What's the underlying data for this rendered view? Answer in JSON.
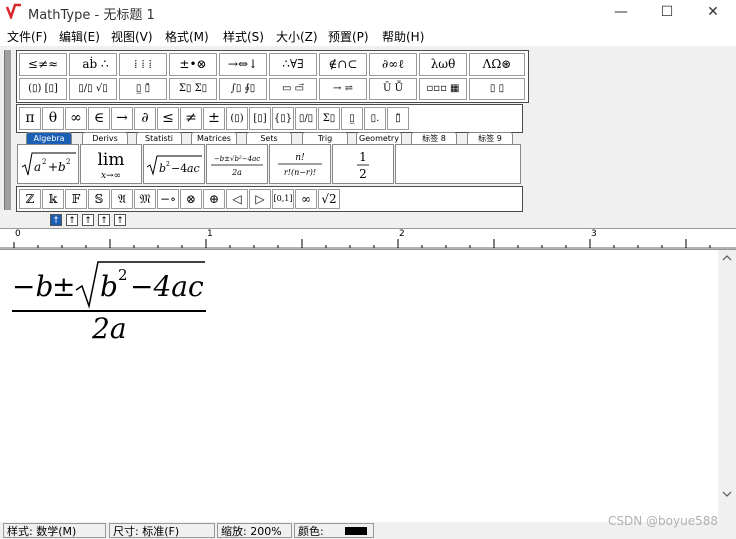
{
  "window": {
    "app_title": "MathType - 无标题 1",
    "minimize_glyph": "—",
    "maximize_glyph": "☐",
    "close_glyph": "✕"
  },
  "menu": [
    "文件(F)",
    "编辑(E)",
    "视图(V)",
    "格式(M)",
    "样式(S)",
    "大小(Z)",
    "预置(P)",
    "帮助(H)"
  ],
  "toolbar": {
    "row1": [
      "≤≠≈",
      "  aḃ ∴",
      "⁞ ⁞ ⁞",
      "±•⊗",
      "→⇔↓",
      "∴∀∃",
      "∉∩⊂",
      "∂∞ℓ",
      "λωθ",
      "ΛΩ⊛"
    ],
    "row2": [
      "(▯) [▯]",
      "▯/▯ √▯",
      "▯̲ ▯̄",
      "Σ▯ Σ▯",
      "∫▯ ∮▯",
      "▭ ▭⃗",
      "→ ⇌",
      "Ū Ṻ",
      "▫▫▫ ▦",
      "▯ ▯"
    ],
    "row3": [
      "π",
      "θ",
      "∞",
      "∈",
      "→",
      "∂",
      "≤",
      "≠",
      "±",
      "(▯)",
      "[▯]",
      "{▯}",
      "▯/▯",
      "Σ▯",
      "▯̲",
      "▯.",
      "▯̈"
    ],
    "tabs": [
      "Algebra",
      "Derivs",
      "Statisti",
      "Matrices",
      "Sets",
      "Trig",
      "Geometry",
      "标签 8",
      "标签 9"
    ],
    "templates": [
      "√(a²+b²)",
      "lim x→∞",
      "√(b²−4ac)",
      "(−b±√(b²−4ac))/2a",
      "n!/r!(n−r)!",
      "1/2"
    ],
    "row5": [
      "ℤ",
      "𝕜",
      "𝔽",
      "𝕊",
      "𝔄",
      "𝔐",
      "−∘",
      "⊗",
      "⊕",
      "◁",
      "▷",
      "[0,1]",
      "∞",
      "√2"
    ],
    "small_buttons": [
      "↑",
      "↑",
      "↑",
      "↑",
      "↑"
    ]
  },
  "ruler": {
    "marks": [
      "0",
      "1",
      "2",
      "3"
    ]
  },
  "equation": {
    "minus_b": "−b",
    "pm": "±",
    "radicand_b": "b",
    "exponent": "2",
    "minus_4ac": "−4ac",
    "denominator": "2a"
  },
  "status": {
    "style": "样式: 数学(M)",
    "size": "尺寸: 标准(F)",
    "zoom": "缩放: 200%",
    "color_label": "颜色:",
    "color_value": "#000000"
  },
  "watermark": "CSDN @boyue588",
  "colors": {
    "active_tab": "#1a5fb4",
    "logo": "#d9262b"
  }
}
